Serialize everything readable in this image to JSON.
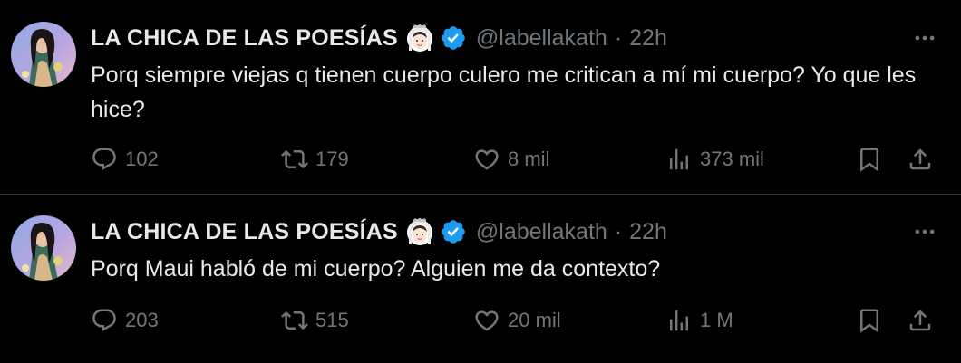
{
  "colors": {
    "background": "#000000",
    "text_primary": "#e7e9ea",
    "text_secondary": "#71767b",
    "verified": "#1d9bf0",
    "divider": "#2f3336"
  },
  "tweets": [
    {
      "author": {
        "display_name": "LA CHICA DE LAS POESÍAS",
        "name_emoji": "bride-with-veil-emoji",
        "verified_icon": "verified-badge-icon",
        "handle": "@labellakath"
      },
      "separator": "·",
      "time": "22h",
      "text": "Porq siempre viejas q tienen cuerpo culero me critican a mí mi cuerpo? Yo que les hice?",
      "actions": {
        "replies": "102",
        "reposts": "179",
        "likes": "8 mil",
        "views": "373 mil"
      }
    },
    {
      "author": {
        "display_name": "LA CHICA DE LAS POESÍAS",
        "name_emoji": "bride-with-veil-emoji",
        "verified_icon": "verified-badge-icon",
        "handle": "@labellakath"
      },
      "separator": "·",
      "time": "22h",
      "text": "Porq Maui habló de mi cuerpo? Alguien me da contexto?",
      "actions": {
        "replies": "203",
        "reposts": "515",
        "likes": "20 mil",
        "views": "1 M"
      }
    }
  ]
}
